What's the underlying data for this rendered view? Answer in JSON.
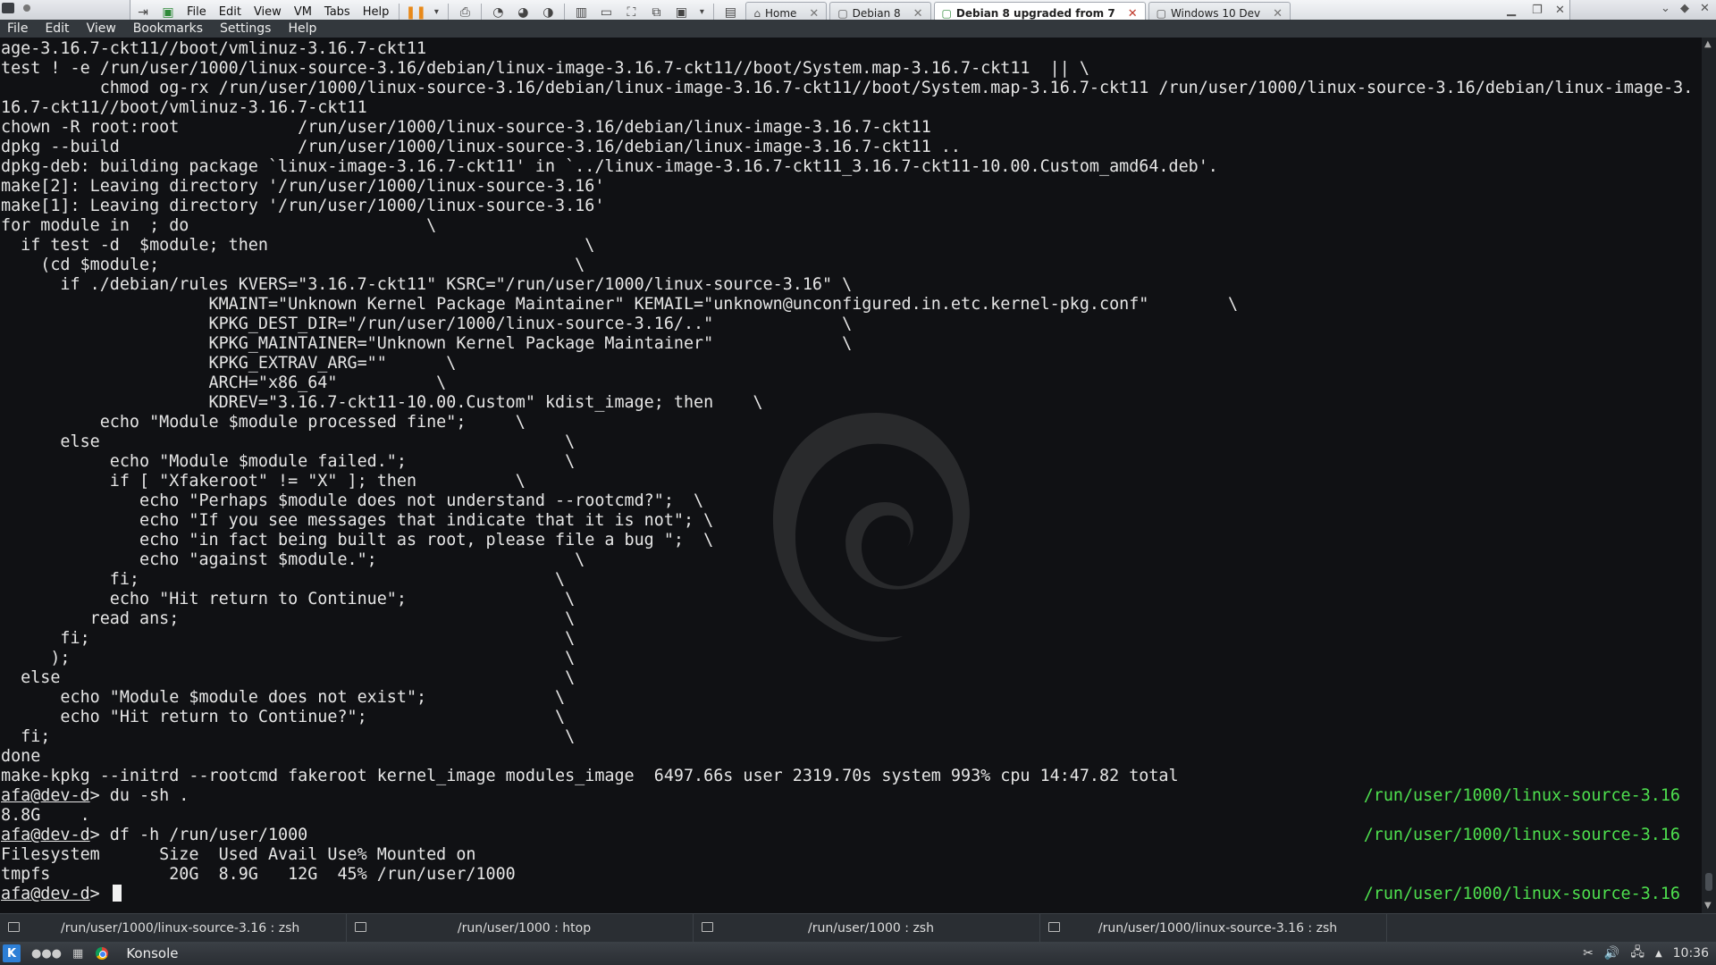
{
  "vmware": {
    "menus": [
      "File",
      "Edit",
      "View",
      "VM",
      "Tabs",
      "Help"
    ],
    "tabs": [
      {
        "label": "Home",
        "icon": "home-icon",
        "active": false
      },
      {
        "label": "Debian 8",
        "icon": "vm-icon",
        "active": false
      },
      {
        "label": "Debian 8 upgraded from 7",
        "icon": "vm-icon",
        "active": true
      },
      {
        "label": "Windows 10 Dev",
        "icon": "vm-icon",
        "active": false
      }
    ]
  },
  "konsole": {
    "menus": [
      "File",
      "Edit",
      "View",
      "Bookmarks",
      "Settings",
      "Help"
    ],
    "lines": [
      "age-3.16.7-ckt11//boot/vmlinuz-3.16.7-ckt11",
      "test ! -e /run/user/1000/linux-source-3.16/debian/linux-image-3.16.7-ckt11//boot/System.map-3.16.7-ckt11  || \\",
      "          chmod og-rx /run/user/1000/linux-source-3.16/debian/linux-image-3.16.7-ckt11//boot/System.map-3.16.7-ckt11 /run/user/1000/linux-source-3.16/debian/linux-image-3.",
      "16.7-ckt11//boot/vmlinuz-3.16.7-ckt11",
      "chown -R root:root            /run/user/1000/linux-source-3.16/debian/linux-image-3.16.7-ckt11",
      "dpkg --build                  /run/user/1000/linux-source-3.16/debian/linux-image-3.16.7-ckt11 ..",
      "dpkg-deb: building package `linux-image-3.16.7-ckt11' in `../linux-image-3.16.7-ckt11_3.16.7-ckt11-10.00.Custom_amd64.deb'.",
      "make[2]: Leaving directory '/run/user/1000/linux-source-3.16'",
      "make[1]: Leaving directory '/run/user/1000/linux-source-3.16'",
      "for module in  ; do                        \\",
      "  if test -d  $module; then                                \\",
      "    (cd $module;                                          \\",
      "      if ./debian/rules KVERS=\"3.16.7-ckt11\" KSRC=\"/run/user/1000/linux-source-3.16\" \\",
      "                     KMAINT=\"Unknown Kernel Package Maintainer\" KEMAIL=\"unknown@unconfigured.in.etc.kernel-pkg.conf\"        \\",
      "                     KPKG_DEST_DIR=\"/run/user/1000/linux-source-3.16/..\"             \\",
      "                     KPKG_MAINTAINER=\"Unknown Kernel Package Maintainer\"             \\",
      "                     KPKG_EXTRAV_ARG=\"\"      \\",
      "                     ARCH=\"x86_64\"          \\",
      "                     KDREV=\"3.16.7-ckt11-10.00.Custom\" kdist_image; then    \\",
      "          echo \"Module $module processed fine\";     \\",
      "      else                                               \\",
      "           echo \"Module $module failed.\";                \\",
      "           if [ \"Xfakeroot\" != \"X\" ]; then          \\",
      "              echo \"Perhaps $module does not understand --rootcmd?\";  \\",
      "              echo \"If you see messages that indicate that it is not\"; \\",
      "              echo \"in fact being built as root, please file a bug \";  \\",
      "              echo \"against $module.\";                    \\",
      "           fi;                                          \\",
      "           echo \"Hit return to Continue\";                \\",
      "         read ans;                                       \\",
      "      fi;                                                \\",
      "     );                                                  \\",
      "  else                                                   \\",
      "      echo \"Module $module does not exist\";             \\",
      "      echo \"Hit return to Continue?\";                   \\",
      "  fi;                                                    \\",
      "done",
      "make-kpkg --initrd --rootcmd fakeroot kernel_image modules_image  6497.66s user 2319.70s system 993% cpu 14:47.82 total"
    ],
    "prompts": [
      {
        "user": "afa@dev-d",
        "rest": "> du -sh .",
        "right": "/run/user/1000/linux-source-3.16"
      },
      {
        "output": "8.8G    ."
      },
      {
        "user": "afa@dev-d",
        "rest": "> df -h /run/user/1000",
        "right": "/run/user/1000/linux-source-3.16"
      },
      {
        "output": "Filesystem      Size  Used Avail Use% Mounted on"
      },
      {
        "output": "tmpfs            20G  8.9G   12G  45% /run/user/1000"
      },
      {
        "user": "afa@dev-d",
        "rest": "> ",
        "right": "/run/user/1000/linux-source-3.16"
      }
    ],
    "tabs": [
      "/run/user/1000/linux-source-3.16 : zsh",
      "/run/user/1000 : htop",
      "/run/user/1000 : zsh",
      "/run/user/1000/linux-source-3.16 : zsh"
    ]
  },
  "panel": {
    "launcher": "K",
    "task": "Konsole",
    "clock": "10:36"
  },
  "colors": {
    "terminal_bg": "#101114",
    "prompt_path": "#4ee04e",
    "konsole_chrome": "#2a2e33"
  }
}
